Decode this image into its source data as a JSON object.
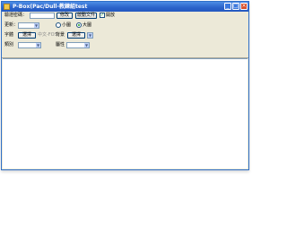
{
  "window": {
    "title": "P-Box(Pac/Dull-教練組test",
    "icon": "app-icon",
    "controls": {
      "minimize": "_",
      "maximize": "□",
      "close": "×"
    }
  },
  "form": {
    "row1": {
      "password_label": "驗證密碼：",
      "password_value": "",
      "modify_button": "修改",
      "launch_button": "啟動文件",
      "check_label": "開放",
      "checked": true
    },
    "row2": {
      "update_label": "更新：",
      "update_value": "",
      "radio_small_label": "小圖",
      "radio_large_label": "大圖",
      "selected": "large"
    },
    "row3": {
      "font_label": "字體",
      "font_button": "選擇",
      "font_hint": "中文-FOS",
      "bg_label": "背景",
      "bg_button": "選擇",
      "bg_value": ""
    },
    "row4": {
      "category_label": "類別",
      "category_value": "",
      "attr_label": "屬性",
      "attr_value": ""
    }
  },
  "colors": {
    "titlebar": "#2a62c9",
    "window_bg": "#ece9d8",
    "border": "#7f9db9",
    "close": "#d6502c"
  }
}
